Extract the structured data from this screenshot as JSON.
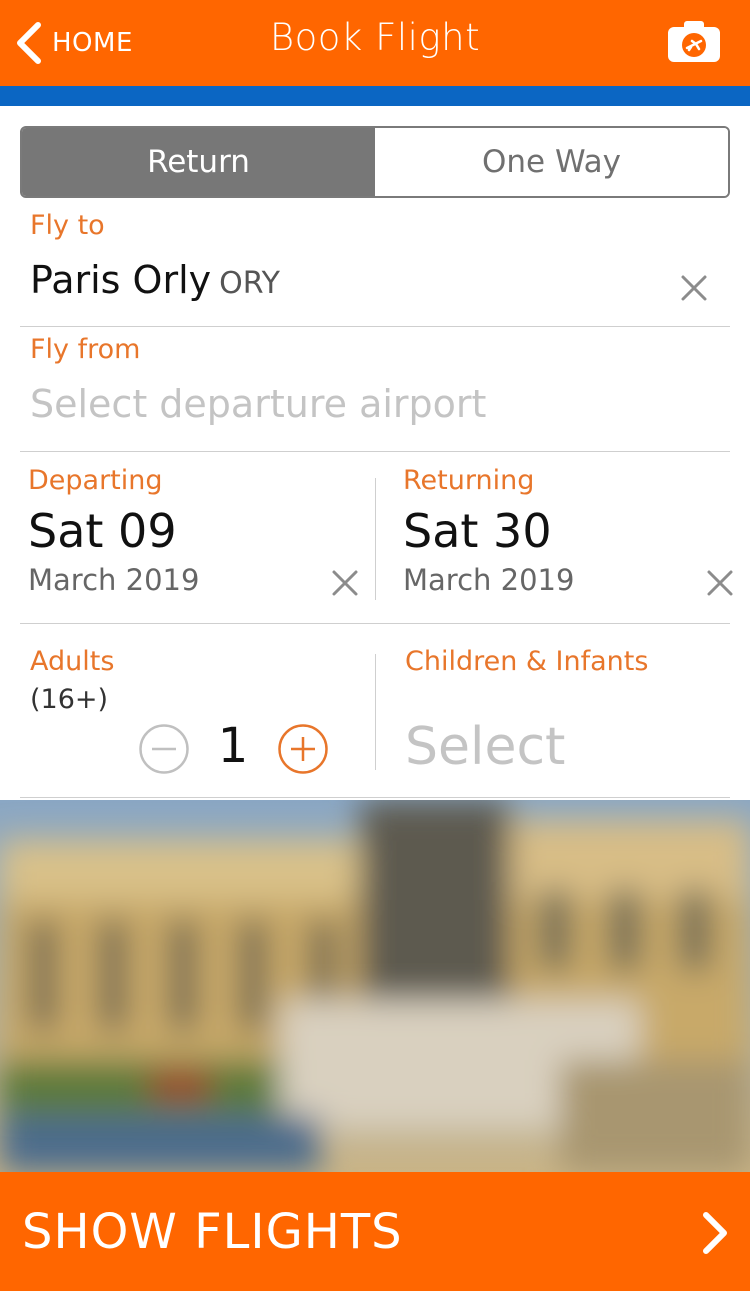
{
  "nav": {
    "back_label": "HOME",
    "title": "Book Flight",
    "icons": {
      "back": "chevron-left-icon",
      "camera": "camera-plane-icon"
    }
  },
  "trip_type": {
    "options": [
      "Return",
      "One Way"
    ],
    "selected": "Return"
  },
  "fly_to": {
    "label": "Fly to",
    "airport": "Paris Orly",
    "code": "ORY"
  },
  "fly_from": {
    "label": "Fly from",
    "placeholder": "Select departure airport"
  },
  "departing": {
    "label": "Departing",
    "day": "Sat 09",
    "month": "March 2019"
  },
  "returning": {
    "label": "Returning",
    "day": "Sat 30",
    "month": "March 2019"
  },
  "adults": {
    "label": "Adults",
    "sub_label": "(16+)",
    "count": "1"
  },
  "children": {
    "label": "Children & Infants",
    "placeholder": "Select"
  },
  "cta": {
    "label": "SHOW FLIGHTS"
  },
  "colors": {
    "brand_orange": "#ff6600",
    "accent_blue": "#0b66c3",
    "label_orange": "#e8762b"
  }
}
